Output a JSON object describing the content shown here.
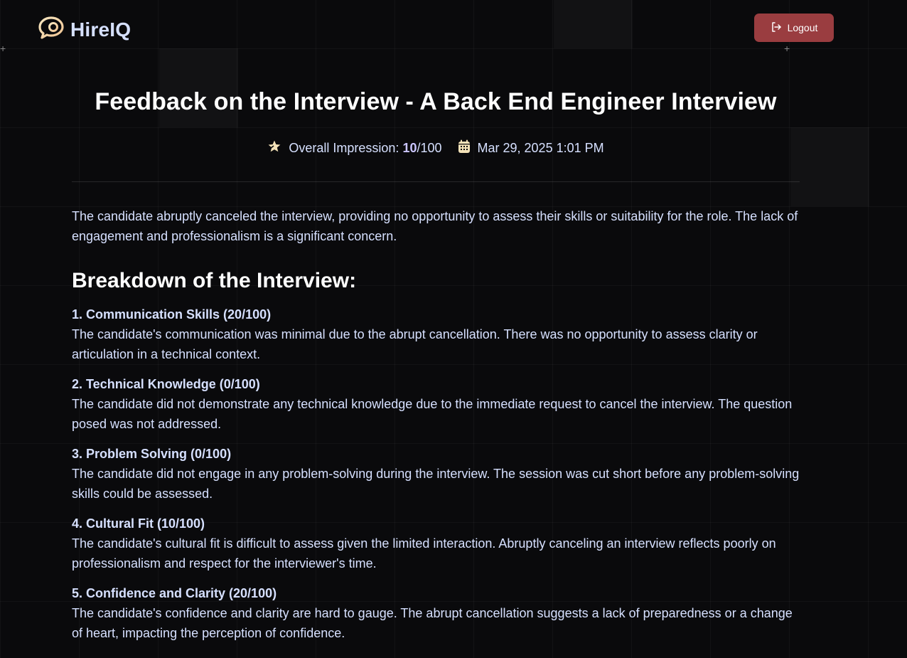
{
  "app": {
    "brand": "HireIQ",
    "logout_label": "Logout"
  },
  "feedback": {
    "title": "Feedback on the Interview - A Back End Engineer Interview",
    "impression_label": "Overall Impression: ",
    "impression_score": "10",
    "impression_total": "/100",
    "date": "Mar 29, 2025 1:01 PM",
    "summary": "The candidate abruptly canceled the interview, providing no opportunity to assess their skills or suitability for the role. The lack of engagement and professionalism is a significant concern."
  },
  "breakdown": {
    "title": "Breakdown of the Interview:",
    "categories": [
      {
        "title": "1. Communication Skills (20/100)",
        "body": "The candidate's communication was minimal due to the abrupt cancellation. There was no opportunity to assess clarity or articulation in a technical context."
      },
      {
        "title": "2. Technical Knowledge (0/100)",
        "body": "The candidate did not demonstrate any technical knowledge due to the immediate request to cancel the interview. The question posed was not addressed."
      },
      {
        "title": "3. Problem Solving (0/100)",
        "body": "The candidate did not engage in any problem-solving during the interview. The session was cut short before any problem-solving skills could be assessed."
      },
      {
        "title": "4. Cultural Fit (10/100)",
        "body": "The candidate's cultural fit is difficult to assess given the limited interaction. Abruptly canceling an interview reflects poorly on professionalism and respect for the interviewer's time."
      },
      {
        "title": "5. Confidence and Clarity (20/100)",
        "body": "The candidate's confidence and clarity are hard to gauge. The abrupt cancellation suggests a lack of preparedness or a change of heart, impacting the perception of confidence."
      }
    ]
  },
  "icons": {
    "logo": "chat-bubble-logo-icon",
    "logout": "logout-icon",
    "impression": "star-icon",
    "date": "calendar-icon"
  },
  "colors": {
    "background": "#0a0a0c",
    "logout_button": "#9a3d40",
    "text": "#d6e0ff",
    "score_accent": "#cac5fe",
    "icon_accent": "#f4e2b8"
  }
}
